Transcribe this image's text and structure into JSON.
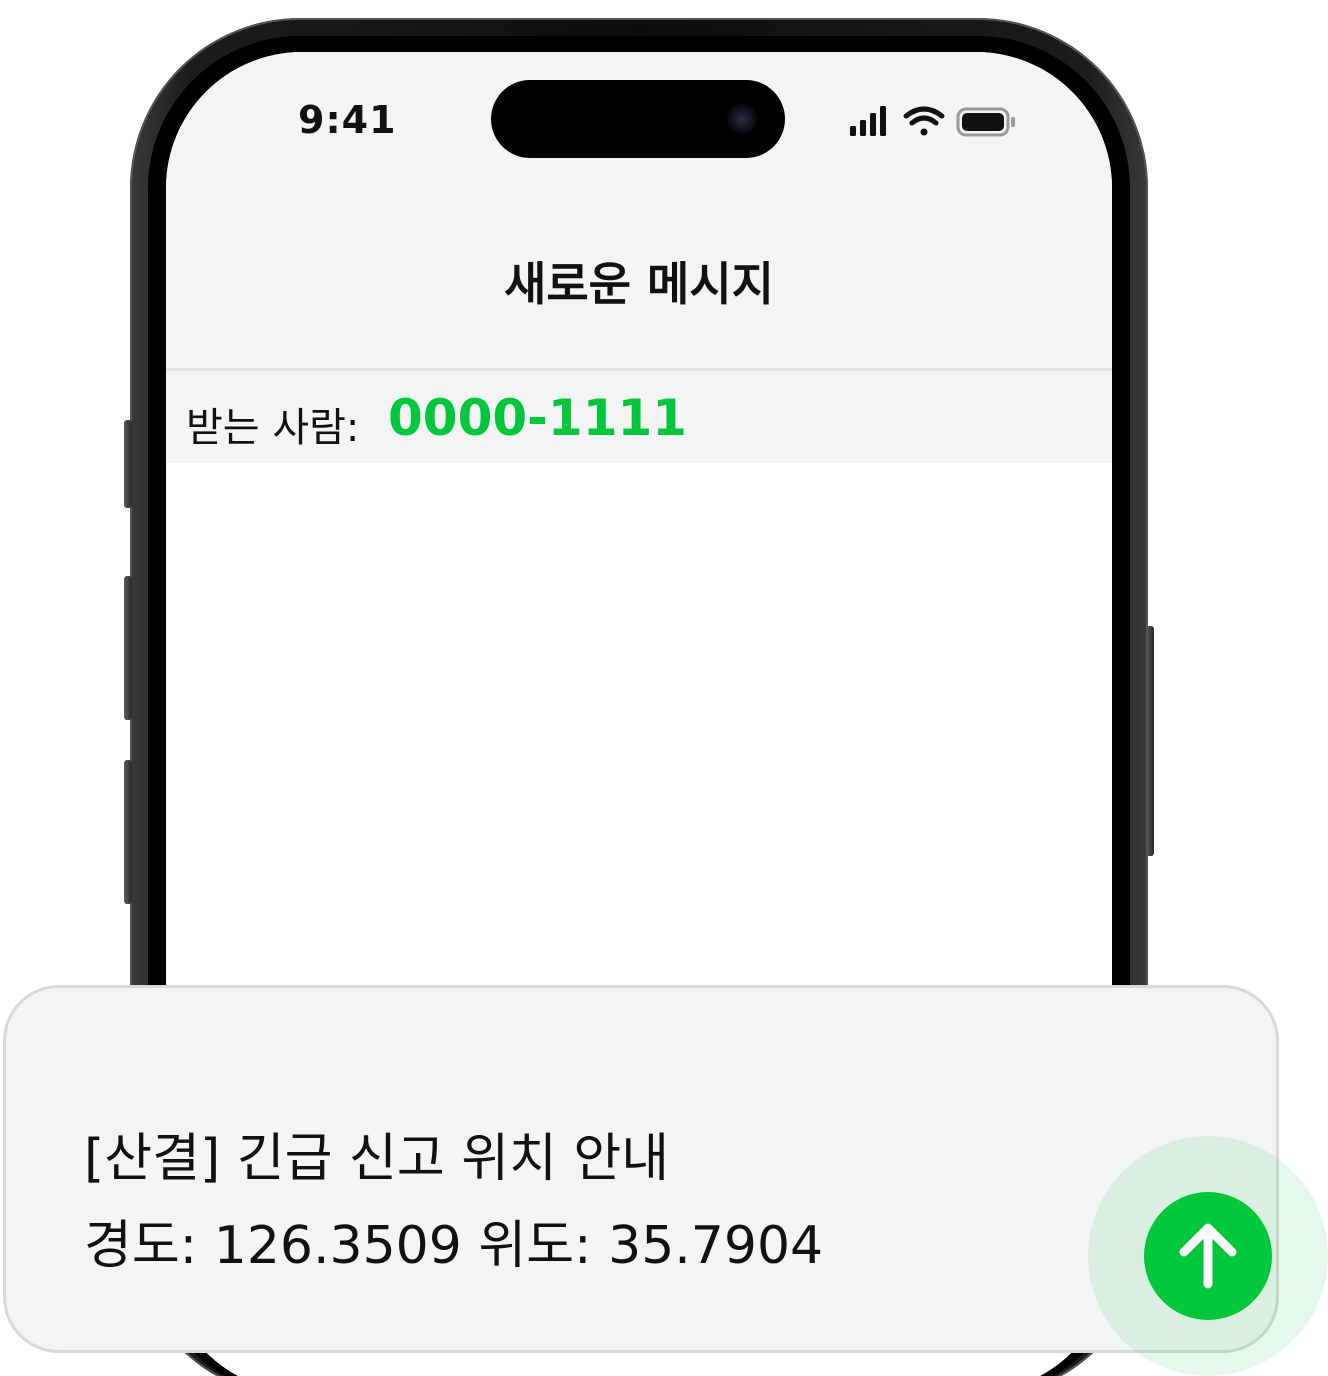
{
  "status_bar": {
    "time": "9:41",
    "icons": [
      "cellular-signal-icon",
      "wifi-icon",
      "battery-icon"
    ]
  },
  "header": {
    "title": "새로운 메시지"
  },
  "recipient": {
    "label": "받는 사람:",
    "number": "0000-1111"
  },
  "composer": {
    "line1": "[산결] 긴급 신고 위치 안내",
    "line2": "경도: 126.3509 위도: 35.7904",
    "send_icon": "arrow-up-icon"
  },
  "colors": {
    "accent": "#00c73c",
    "screen_background": "#f4f4f4",
    "text": "#111111"
  }
}
